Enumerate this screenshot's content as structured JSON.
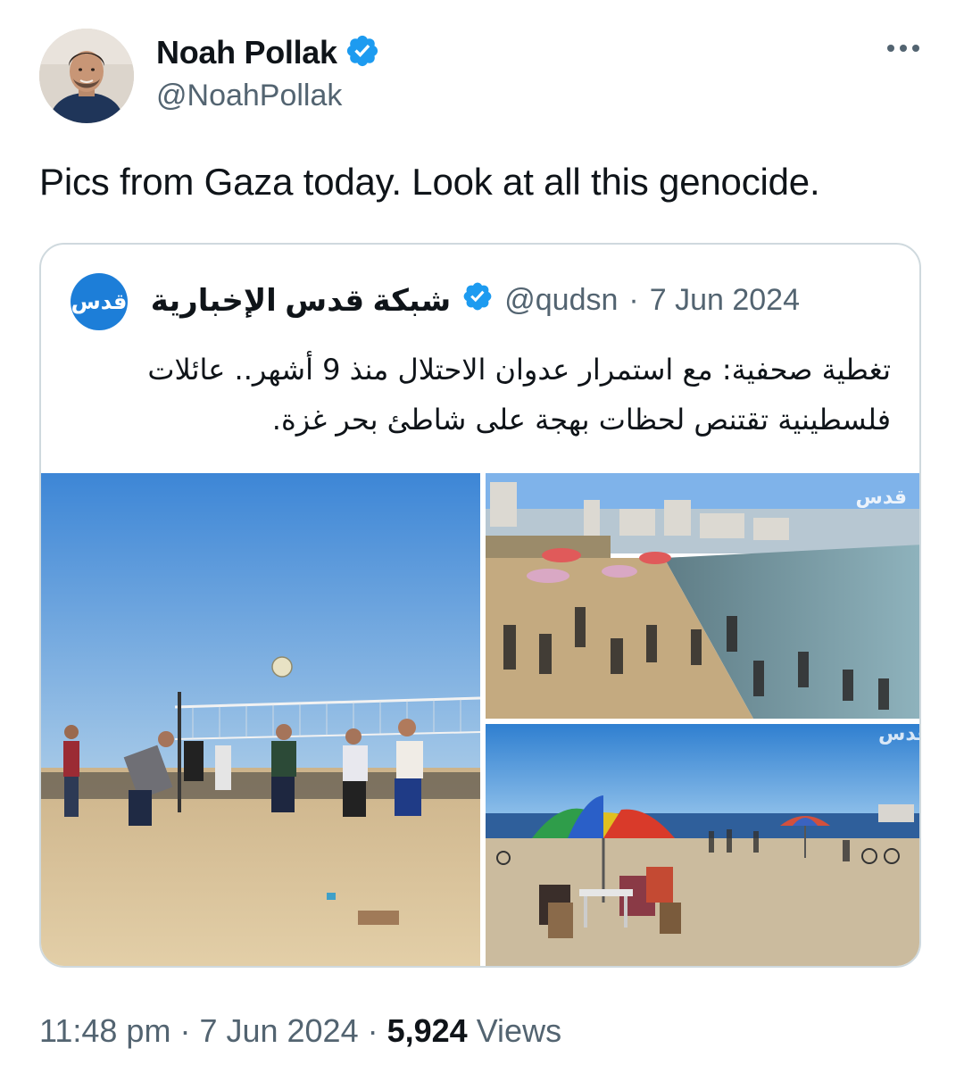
{
  "author": {
    "display_name": "Noah Pollak",
    "handle": "@NoahPollak",
    "verified_icon": "verified-badge-icon"
  },
  "tweet": {
    "text": "Pics from Gaza today. Look at all this genocide."
  },
  "quoted": {
    "avatar_text": "قدس",
    "display_name": "شبكة قدس الإخبارية",
    "handle": "@qudsn",
    "separator": "·",
    "date": "7 Jun 2024",
    "text_line1": "تغطية صحفية: مع استمرار عدوان الاحتلال منذ 9 أشهر.. عائلات",
    "text_line2": "فلسطينية تقتنص لحظات بهجة على شاطئ بحر غزة.",
    "watermark": "قدس"
  },
  "footer": {
    "time": "11:48 pm",
    "sep1": "·",
    "date": "7 Jun 2024",
    "sep2": "·",
    "views_count": "5,924",
    "views_label": "Views"
  },
  "colors": {
    "verified": "#1d9bf0",
    "secondary_text": "#536471",
    "border": "#cfd9de",
    "brand_blue": "#1d7ed8"
  }
}
